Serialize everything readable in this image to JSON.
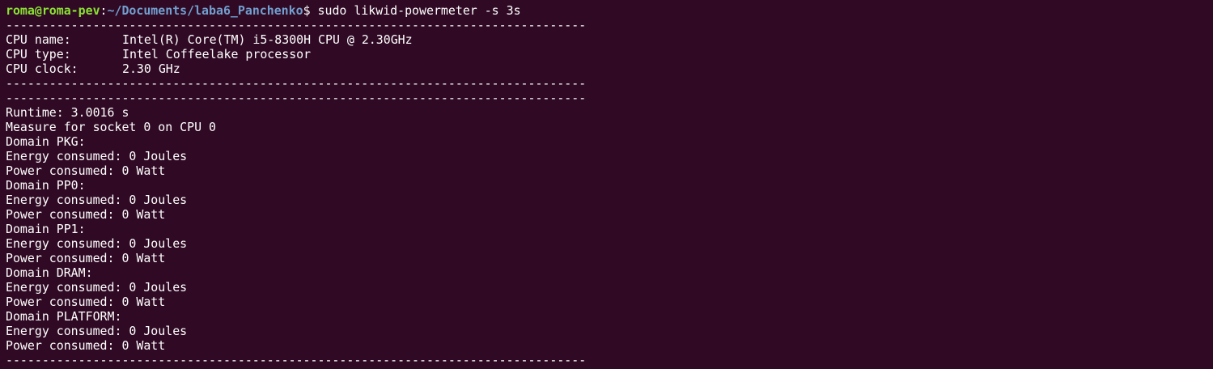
{
  "prompt": {
    "user_host": "roma@roma-pev",
    "colon": ":",
    "path": "~/Documents/laba6_Panchenko",
    "symbol": "$ ",
    "command": "sudo likwid-powermeter -s 3s"
  },
  "separator": "--------------------------------------------------------------------------------",
  "cpu_info": {
    "name_label": "CPU name:",
    "name_value": "Intel(R) Core(TM) i5-8300H CPU @ 2.30GHz",
    "type_label": "CPU type:",
    "type_value": "Intel Coffeelake processor",
    "clock_label": "CPU clock:",
    "clock_value": "2.30 GHz"
  },
  "runtime": "Runtime: 3.0016 s",
  "measure": "Measure for socket 0 on CPU 0",
  "domains": [
    {
      "header": "Domain PKG:",
      "energy": "Energy consumed: 0 Joules",
      "power": "Power consumed: 0 Watt"
    },
    {
      "header": "Domain PP0:",
      "energy": "Energy consumed: 0 Joules",
      "power": "Power consumed: 0 Watt"
    },
    {
      "header": "Domain PP1:",
      "energy": "Energy consumed: 0 Joules",
      "power": "Power consumed: 0 Watt"
    },
    {
      "header": "Domain DRAM:",
      "energy": "Energy consumed: 0 Joules",
      "power": "Power consumed: 0 Watt"
    },
    {
      "header": "Domain PLATFORM:",
      "energy": "Energy consumed: 0 Joules",
      "power": "Power consumed: 0 Watt"
    }
  ]
}
